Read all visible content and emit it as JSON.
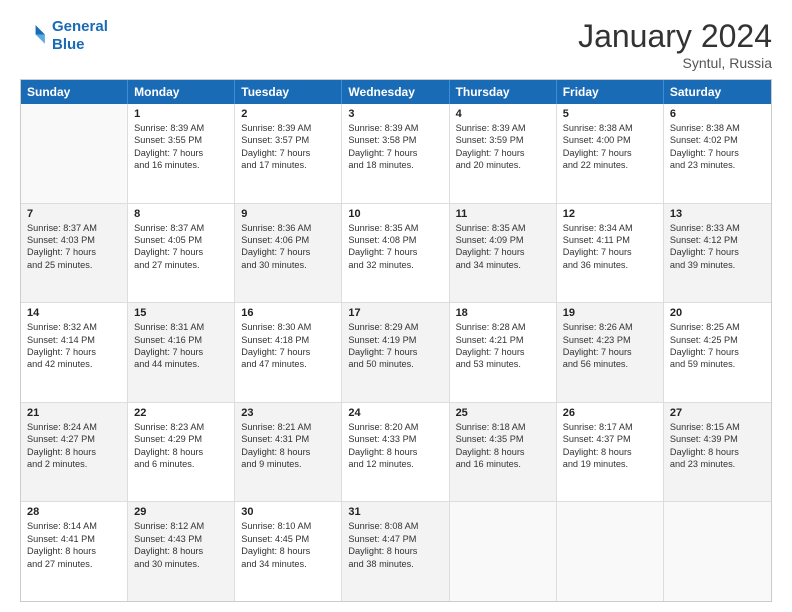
{
  "header": {
    "logo_line1": "General",
    "logo_line2": "Blue",
    "month": "January 2024",
    "location": "Syntul, Russia"
  },
  "weekdays": [
    "Sunday",
    "Monday",
    "Tuesday",
    "Wednesday",
    "Thursday",
    "Friday",
    "Saturday"
  ],
  "rows": [
    [
      {
        "day": "",
        "lines": [],
        "empty": true
      },
      {
        "day": "1",
        "lines": [
          "Sunrise: 8:39 AM",
          "Sunset: 3:55 PM",
          "Daylight: 7 hours",
          "and 16 minutes."
        ]
      },
      {
        "day": "2",
        "lines": [
          "Sunrise: 8:39 AM",
          "Sunset: 3:57 PM",
          "Daylight: 7 hours",
          "and 17 minutes."
        ]
      },
      {
        "day": "3",
        "lines": [
          "Sunrise: 8:39 AM",
          "Sunset: 3:58 PM",
          "Daylight: 7 hours",
          "and 18 minutes."
        ]
      },
      {
        "day": "4",
        "lines": [
          "Sunrise: 8:39 AM",
          "Sunset: 3:59 PM",
          "Daylight: 7 hours",
          "and 20 minutes."
        ]
      },
      {
        "day": "5",
        "lines": [
          "Sunrise: 8:38 AM",
          "Sunset: 4:00 PM",
          "Daylight: 7 hours",
          "and 22 minutes."
        ]
      },
      {
        "day": "6",
        "lines": [
          "Sunrise: 8:38 AM",
          "Sunset: 4:02 PM",
          "Daylight: 7 hours",
          "and 23 minutes."
        ]
      }
    ],
    [
      {
        "day": "7",
        "lines": [
          "Sunrise: 8:37 AM",
          "Sunset: 4:03 PM",
          "Daylight: 7 hours",
          "and 25 minutes."
        ],
        "alt": true
      },
      {
        "day": "8",
        "lines": [
          "Sunrise: 8:37 AM",
          "Sunset: 4:05 PM",
          "Daylight: 7 hours",
          "and 27 minutes."
        ]
      },
      {
        "day": "9",
        "lines": [
          "Sunrise: 8:36 AM",
          "Sunset: 4:06 PM",
          "Daylight: 7 hours",
          "and 30 minutes."
        ],
        "alt": true
      },
      {
        "day": "10",
        "lines": [
          "Sunrise: 8:35 AM",
          "Sunset: 4:08 PM",
          "Daylight: 7 hours",
          "and 32 minutes."
        ]
      },
      {
        "day": "11",
        "lines": [
          "Sunrise: 8:35 AM",
          "Sunset: 4:09 PM",
          "Daylight: 7 hours",
          "and 34 minutes."
        ],
        "alt": true
      },
      {
        "day": "12",
        "lines": [
          "Sunrise: 8:34 AM",
          "Sunset: 4:11 PM",
          "Daylight: 7 hours",
          "and 36 minutes."
        ]
      },
      {
        "day": "13",
        "lines": [
          "Sunrise: 8:33 AM",
          "Sunset: 4:12 PM",
          "Daylight: 7 hours",
          "and 39 minutes."
        ],
        "alt": true
      }
    ],
    [
      {
        "day": "14",
        "lines": [
          "Sunrise: 8:32 AM",
          "Sunset: 4:14 PM",
          "Daylight: 7 hours",
          "and 42 minutes."
        ]
      },
      {
        "day": "15",
        "lines": [
          "Sunrise: 8:31 AM",
          "Sunset: 4:16 PM",
          "Daylight: 7 hours",
          "and 44 minutes."
        ],
        "alt": true
      },
      {
        "day": "16",
        "lines": [
          "Sunrise: 8:30 AM",
          "Sunset: 4:18 PM",
          "Daylight: 7 hours",
          "and 47 minutes."
        ]
      },
      {
        "day": "17",
        "lines": [
          "Sunrise: 8:29 AM",
          "Sunset: 4:19 PM",
          "Daylight: 7 hours",
          "and 50 minutes."
        ],
        "alt": true
      },
      {
        "day": "18",
        "lines": [
          "Sunrise: 8:28 AM",
          "Sunset: 4:21 PM",
          "Daylight: 7 hours",
          "and 53 minutes."
        ]
      },
      {
        "day": "19",
        "lines": [
          "Sunrise: 8:26 AM",
          "Sunset: 4:23 PM",
          "Daylight: 7 hours",
          "and 56 minutes."
        ],
        "alt": true
      },
      {
        "day": "20",
        "lines": [
          "Sunrise: 8:25 AM",
          "Sunset: 4:25 PM",
          "Daylight: 7 hours",
          "and 59 minutes."
        ]
      }
    ],
    [
      {
        "day": "21",
        "lines": [
          "Sunrise: 8:24 AM",
          "Sunset: 4:27 PM",
          "Daylight: 8 hours",
          "and 2 minutes."
        ],
        "alt": true
      },
      {
        "day": "22",
        "lines": [
          "Sunrise: 8:23 AM",
          "Sunset: 4:29 PM",
          "Daylight: 8 hours",
          "and 6 minutes."
        ]
      },
      {
        "day": "23",
        "lines": [
          "Sunrise: 8:21 AM",
          "Sunset: 4:31 PM",
          "Daylight: 8 hours",
          "and 9 minutes."
        ],
        "alt": true
      },
      {
        "day": "24",
        "lines": [
          "Sunrise: 8:20 AM",
          "Sunset: 4:33 PM",
          "Daylight: 8 hours",
          "and 12 minutes."
        ]
      },
      {
        "day": "25",
        "lines": [
          "Sunrise: 8:18 AM",
          "Sunset: 4:35 PM",
          "Daylight: 8 hours",
          "and 16 minutes."
        ],
        "alt": true
      },
      {
        "day": "26",
        "lines": [
          "Sunrise: 8:17 AM",
          "Sunset: 4:37 PM",
          "Daylight: 8 hours",
          "and 19 minutes."
        ]
      },
      {
        "day": "27",
        "lines": [
          "Sunrise: 8:15 AM",
          "Sunset: 4:39 PM",
          "Daylight: 8 hours",
          "and 23 minutes."
        ],
        "alt": true
      }
    ],
    [
      {
        "day": "28",
        "lines": [
          "Sunrise: 8:14 AM",
          "Sunset: 4:41 PM",
          "Daylight: 8 hours",
          "and 27 minutes."
        ]
      },
      {
        "day": "29",
        "lines": [
          "Sunrise: 8:12 AM",
          "Sunset: 4:43 PM",
          "Daylight: 8 hours",
          "and 30 minutes."
        ],
        "alt": true
      },
      {
        "day": "30",
        "lines": [
          "Sunrise: 8:10 AM",
          "Sunset: 4:45 PM",
          "Daylight: 8 hours",
          "and 34 minutes."
        ]
      },
      {
        "day": "31",
        "lines": [
          "Sunrise: 8:08 AM",
          "Sunset: 4:47 PM",
          "Daylight: 8 hours",
          "and 38 minutes."
        ],
        "alt": true
      },
      {
        "day": "",
        "lines": [],
        "empty": true
      },
      {
        "day": "",
        "lines": [],
        "empty": true
      },
      {
        "day": "",
        "lines": [],
        "empty": true
      }
    ]
  ]
}
